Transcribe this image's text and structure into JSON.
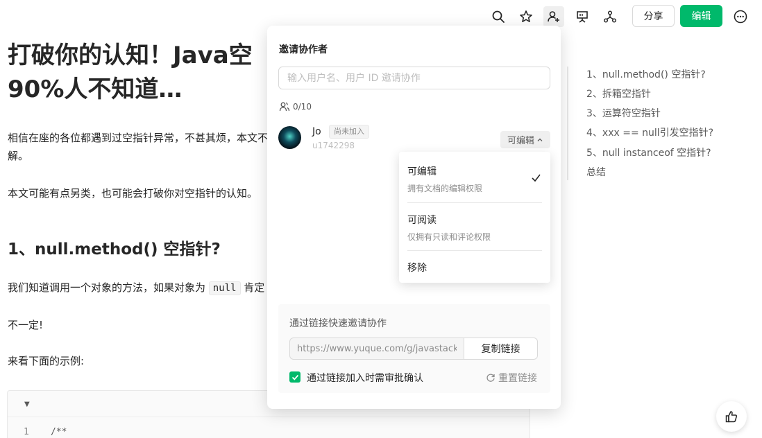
{
  "toolbar": {
    "icons": [
      "search-icon",
      "star-icon",
      "add-collaborator-icon",
      "present-icon",
      "graph-icon",
      "more-icon"
    ],
    "share_label": "分享",
    "edit_label": "编辑",
    "accent": "#00b96b"
  },
  "article": {
    "title_line1": "打破你的认知！Java空",
    "title_line2": "90%人不知道…",
    "intro_line1": "相信在座的各位都遇到过空指针异常，不甚其烦，本文不",
    "intro_line2": "解。",
    "para2": "本文可能有点另类，也可能会打破你对空指针的认知。",
    "h2_1": "1、null.method() 空指针?",
    "para3_prefix": "我们知道调用一个对象的方法，如果对象为",
    "para3_code": "null",
    "para3_suffix": "肯定",
    "para4": "不一定!",
    "para5": "来看下面的示例:",
    "code_line_number": "1",
    "code_line_text": "/**"
  },
  "toc": {
    "items": [
      "1、null.method() 空指针?",
      "2、拆箱空指针",
      "3、运算符空指针",
      "4、xxx == null引发空指针?",
      "5、null instanceof 空指针?",
      "总结"
    ]
  },
  "invite_panel": {
    "title": "邀请协作者",
    "search_placeholder": "输入用户名、用户 ID 邀请协作",
    "member_count": "0/10",
    "member": {
      "name": "Jo",
      "badge": "尚未加入",
      "user_id": "u1742298",
      "permission": "可编辑"
    },
    "link_section_title": "通过链接快速邀请协作",
    "link_value": "https://www.yuque.com/g/javastack",
    "copy_label": "复制链接",
    "approval_label": "通过链接加入时需审批确认",
    "approval_checked": true,
    "reset_label": "重置链接"
  },
  "permission_menu": {
    "items": [
      {
        "title": "可编辑",
        "desc": "拥有文档的编辑权限",
        "selected": true
      },
      {
        "title": "可阅读",
        "desc": "仅拥有只读和评论权限",
        "selected": false
      },
      {
        "title": "移除",
        "desc": "",
        "selected": false
      }
    ]
  }
}
